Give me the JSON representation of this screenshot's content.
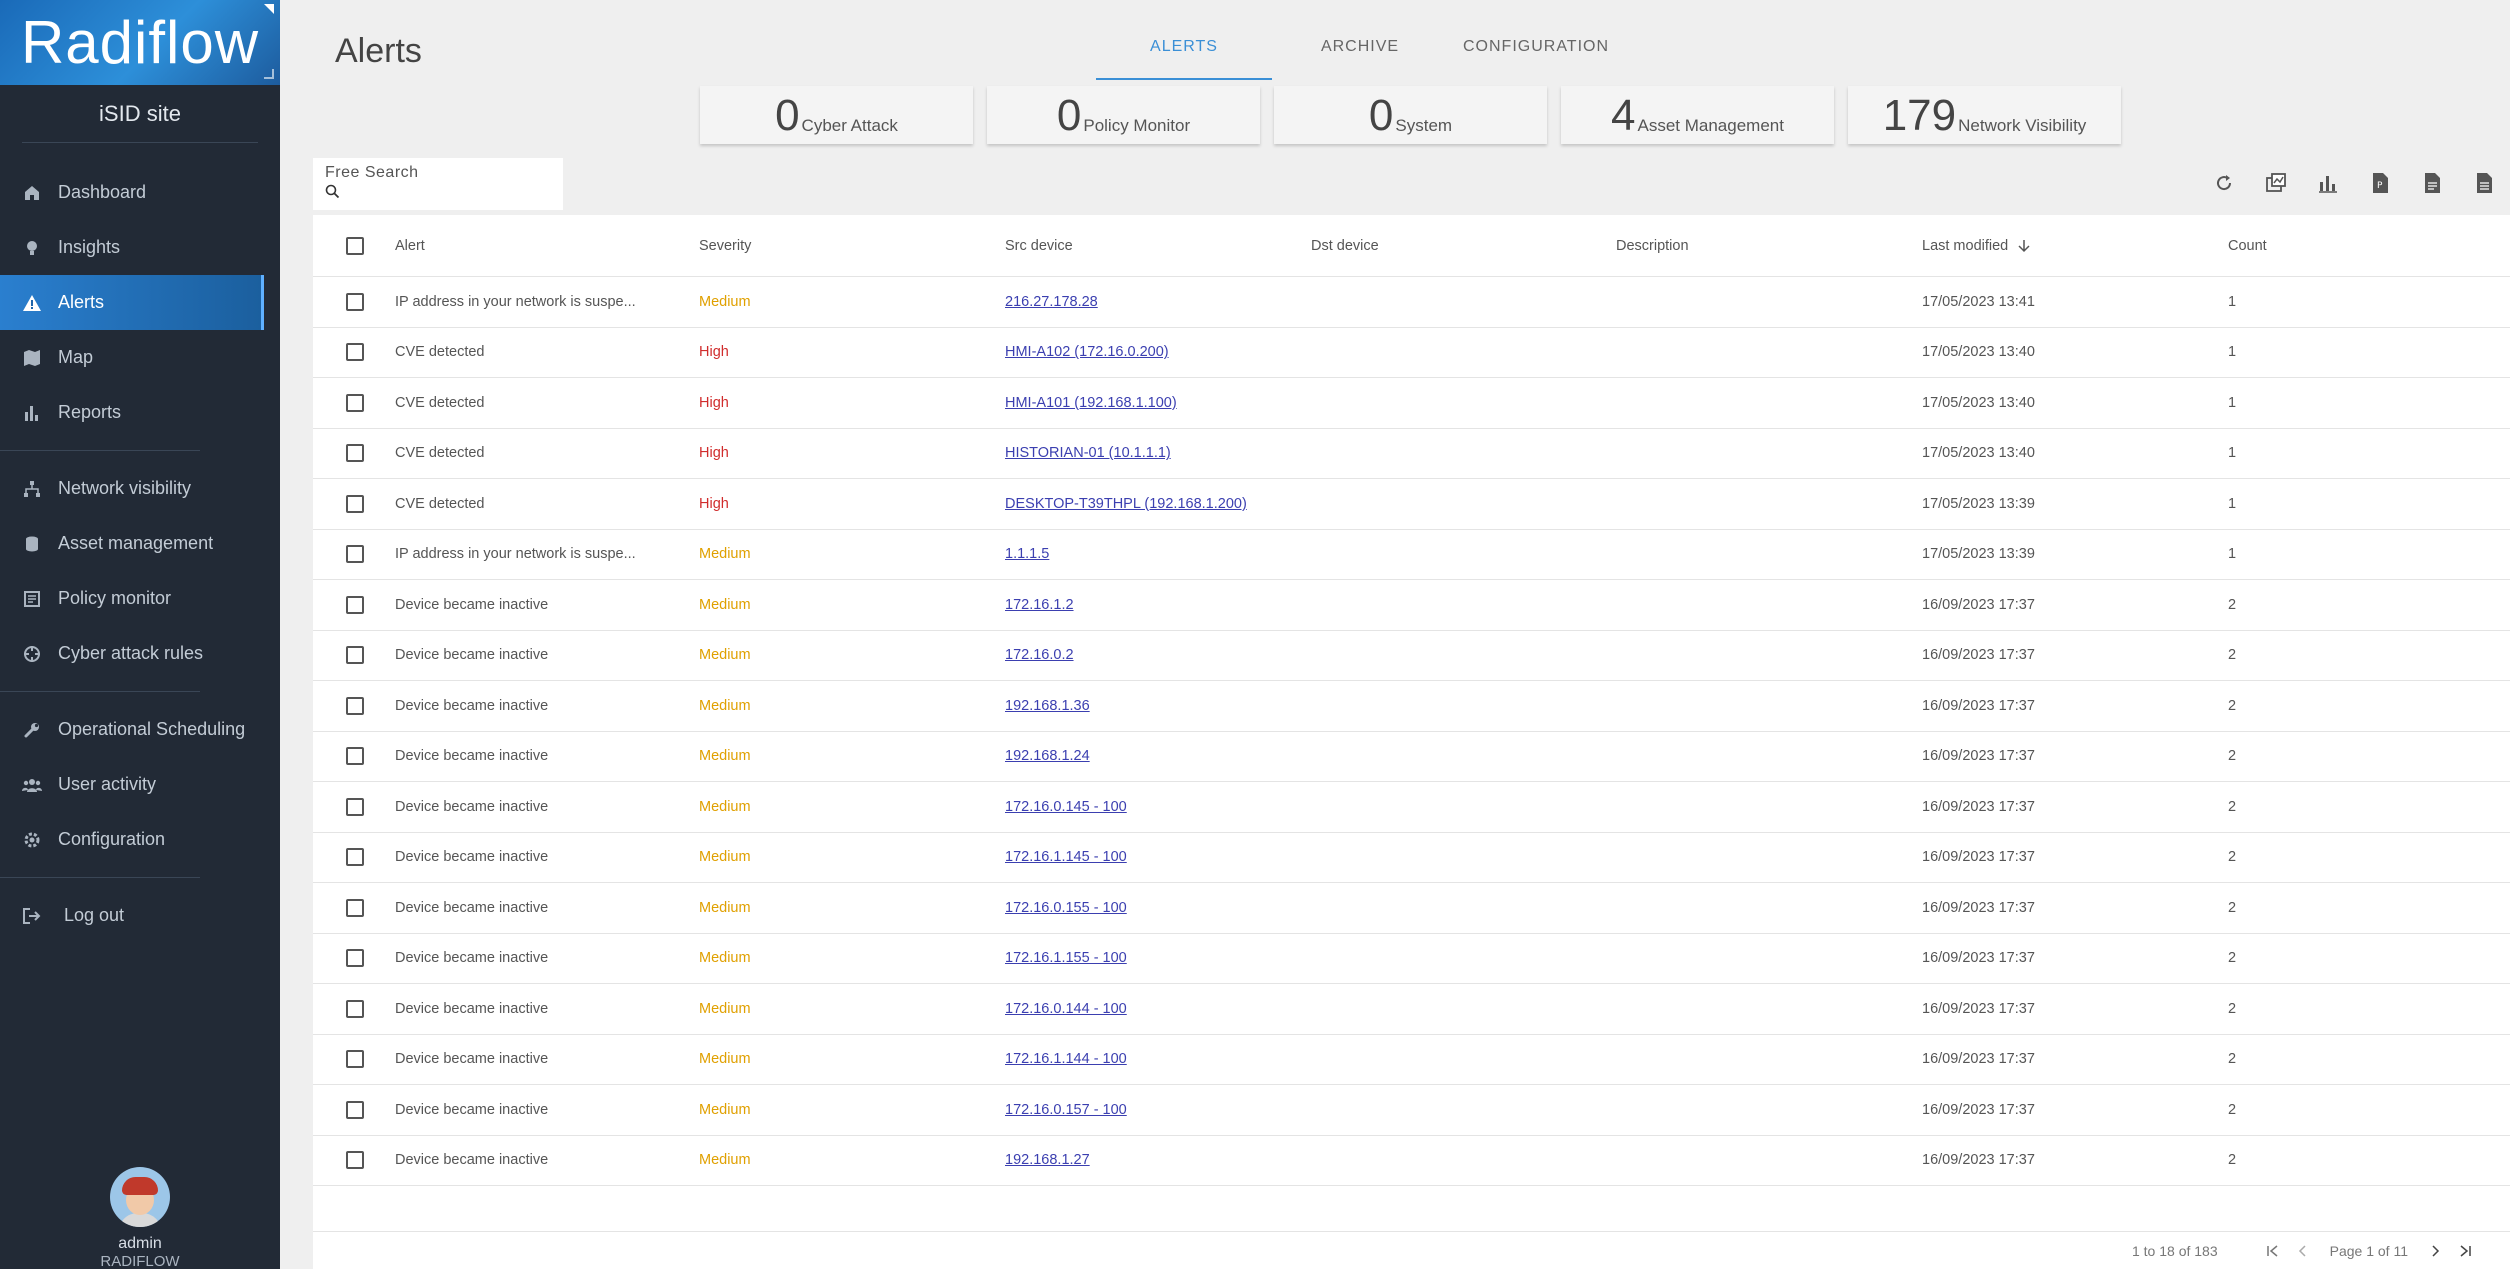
{
  "sidebar": {
    "logo": "Radiflow",
    "site": "iSID site",
    "items": [
      {
        "label": "Dashboard",
        "icon": "home-icon"
      },
      {
        "label": "Insights",
        "icon": "bulb-icon"
      },
      {
        "label": "Alerts",
        "icon": "warning-icon"
      },
      {
        "label": "Map",
        "icon": "map-icon"
      },
      {
        "label": "Reports",
        "icon": "bar-chart-icon"
      },
      {
        "label": "Network visibility",
        "icon": "sitemap-icon"
      },
      {
        "label": "Asset management",
        "icon": "database-icon"
      },
      {
        "label": "Policy monitor",
        "icon": "document-icon"
      },
      {
        "label": "Cyber attack rules",
        "icon": "crosshair-icon"
      },
      {
        "label": "Operational Scheduling",
        "icon": "wrench-icon"
      },
      {
        "label": "User activity",
        "icon": "users-icon"
      },
      {
        "label": "Configuration",
        "icon": "gear-icon"
      },
      {
        "label": "Log out",
        "icon": "logout-icon"
      }
    ],
    "user": {
      "name": "admin",
      "org": "RADIFLOW"
    }
  },
  "header": {
    "title": "Alerts",
    "tabs": [
      "ALERTS",
      "ARCHIVE",
      "CONFIGURATION"
    ],
    "active_tab": "ALERTS"
  },
  "stats": [
    {
      "count": "0",
      "label": "Cyber Attack"
    },
    {
      "count": "0",
      "label": "Policy Monitor"
    },
    {
      "count": "0",
      "label": "System"
    },
    {
      "count": "4",
      "label": "Asset Management"
    },
    {
      "count": "179",
      "label": "Network Visibility"
    }
  ],
  "search": {
    "label": "Free Search",
    "placeholder": ""
  },
  "table": {
    "columns": [
      "Alert",
      "Severity",
      "Src device",
      "Dst device",
      "Description",
      "Last modified",
      "Count"
    ],
    "rows": [
      {
        "alert": "IP address in your network is suspe...",
        "severity": "Medium",
        "src": "216.27.178.28",
        "dst": "",
        "desc": "",
        "modified": "17/05/2023 13:41",
        "count": "1"
      },
      {
        "alert": "CVE detected",
        "severity": "High",
        "src": "HMI-A102 (172.16.0.200)",
        "dst": "",
        "desc": "",
        "modified": "17/05/2023 13:40",
        "count": "1"
      },
      {
        "alert": "CVE detected",
        "severity": "High",
        "src": "HMI-A101 (192.168.1.100)",
        "dst": "",
        "desc": "",
        "modified": "17/05/2023 13:40",
        "count": "1"
      },
      {
        "alert": "CVE detected",
        "severity": "High",
        "src": "HISTORIAN-01 (10.1.1.1)",
        "dst": "",
        "desc": "",
        "modified": "17/05/2023 13:40",
        "count": "1"
      },
      {
        "alert": "CVE detected",
        "severity": "High",
        "src": "DESKTOP-T39THPL (192.168.1.200)",
        "dst": "",
        "desc": "",
        "modified": "17/05/2023 13:39",
        "count": "1"
      },
      {
        "alert": "IP address in your network is suspe...",
        "severity": "Medium",
        "src": "1.1.1.5",
        "dst": "",
        "desc": "",
        "modified": "17/05/2023 13:39",
        "count": "1"
      },
      {
        "alert": "Device became inactive",
        "severity": "Medium",
        "src": "172.16.1.2",
        "dst": "",
        "desc": "",
        "modified": "16/09/2023 17:37",
        "count": "2"
      },
      {
        "alert": "Device became inactive",
        "severity": "Medium",
        "src": "172.16.0.2",
        "dst": "",
        "desc": "",
        "modified": "16/09/2023 17:37",
        "count": "2"
      },
      {
        "alert": "Device became inactive",
        "severity": "Medium",
        "src": "192.168.1.36",
        "dst": "",
        "desc": "",
        "modified": "16/09/2023 17:37",
        "count": "2"
      },
      {
        "alert": "Device became inactive",
        "severity": "Medium",
        "src": "192.168.1.24",
        "dst": "",
        "desc": "",
        "modified": "16/09/2023 17:37",
        "count": "2"
      },
      {
        "alert": "Device became inactive",
        "severity": "Medium",
        "src": "172.16.0.145 - 100",
        "dst": "",
        "desc": "",
        "modified": "16/09/2023 17:37",
        "count": "2"
      },
      {
        "alert": "Device became inactive",
        "severity": "Medium",
        "src": "172.16.1.145 - 100",
        "dst": "",
        "desc": "",
        "modified": "16/09/2023 17:37",
        "count": "2"
      },
      {
        "alert": "Device became inactive",
        "severity": "Medium",
        "src": "172.16.0.155 - 100",
        "dst": "",
        "desc": "",
        "modified": "16/09/2023 17:37",
        "count": "2"
      },
      {
        "alert": "Device became inactive",
        "severity": "Medium",
        "src": "172.16.1.155 - 100",
        "dst": "",
        "desc": "",
        "modified": "16/09/2023 17:37",
        "count": "2"
      },
      {
        "alert": "Device became inactive",
        "severity": "Medium",
        "src": "172.16.0.144 - 100",
        "dst": "",
        "desc": "",
        "modified": "16/09/2023 17:37",
        "count": "2"
      },
      {
        "alert": "Device became inactive",
        "severity": "Medium",
        "src": "172.16.1.144 - 100",
        "dst": "",
        "desc": "",
        "modified": "16/09/2023 17:37",
        "count": "2"
      },
      {
        "alert": "Device became inactive",
        "severity": "Medium",
        "src": "172.16.0.157 - 100",
        "dst": "",
        "desc": "",
        "modified": "16/09/2023 17:37",
        "count": "2"
      },
      {
        "alert": "Device became inactive",
        "severity": "Medium",
        "src": "192.168.1.27",
        "dst": "",
        "desc": "",
        "modified": "16/09/2023 17:37",
        "count": "2"
      }
    ]
  },
  "pagination": {
    "range": "1 to 18 of 183",
    "page": "Page 1 of 11"
  },
  "toolbar": [
    "refresh-icon",
    "export-map-icon",
    "bar-chart-icon",
    "pdf-icon",
    "csv-icon",
    "file-icon"
  ],
  "colors": {
    "accent": "#3a8fd6",
    "sidebar": "#222a36",
    "medium": "#e0a000",
    "high": "#d02c2c",
    "link": "#3b3fb0"
  }
}
